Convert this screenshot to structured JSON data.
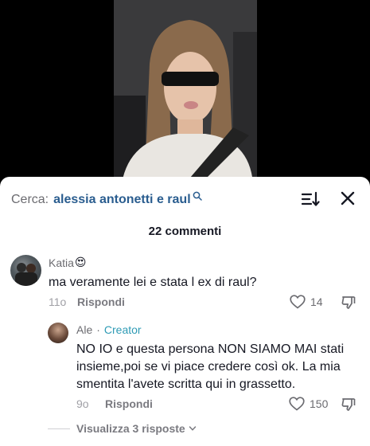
{
  "search": {
    "prefix": "Cerca:",
    "query": "alessia antonetti e raul"
  },
  "comments_header": {
    "count_label": "22 commenti"
  },
  "comment": {
    "author": "Katia",
    "author_emoji": "😍",
    "text": "ma veramente lei e stata l ex di raul?",
    "time": "11o",
    "reply_label": "Rispondi",
    "likes": "14"
  },
  "reply": {
    "author": "Ale",
    "separator": "·",
    "badge": "Creator",
    "text": "NO IO e questa persona NON SIAMO MAI stati insieme,poi se vi piace credere così ok. La mia smentita l'avete scritta qui in grassetto.",
    "time": "9o",
    "reply_label": "Rispondi",
    "likes": "150"
  },
  "view_replies": {
    "label": "Visualizza 3 risposte"
  },
  "colors": {
    "link_blue": "#2a5d8f",
    "creator_teal": "#2f9bb5",
    "muted": "#6b6b70"
  }
}
